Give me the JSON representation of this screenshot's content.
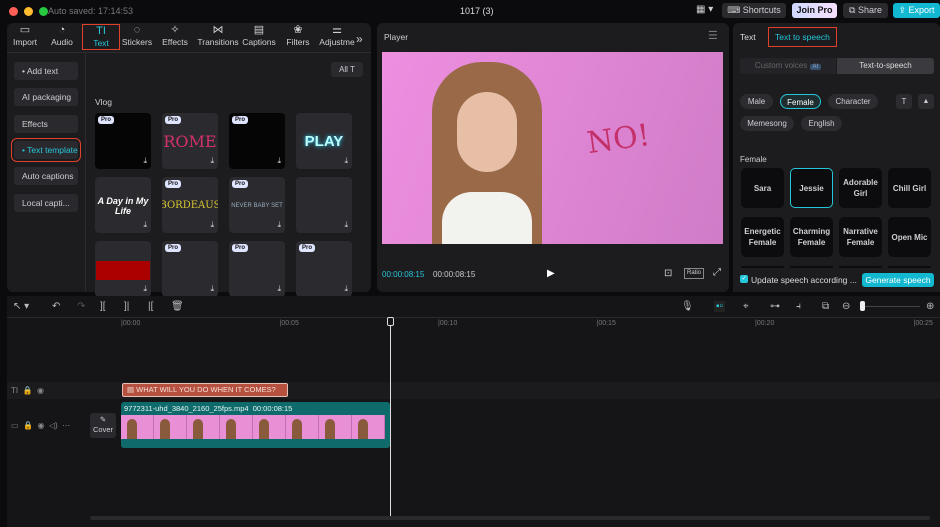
{
  "titlebar": {
    "autosave": "Auto saved: 17:14:53",
    "project": "1017 (3)",
    "shortcuts": "Shortcuts",
    "join_pro": "Join Pro",
    "share": "Share",
    "export": "Export"
  },
  "toolbar_tabs": [
    {
      "label": "Import",
      "icon": "import-icon"
    },
    {
      "label": "Audio",
      "icon": "audio-icon"
    },
    {
      "label": "Text",
      "icon": "text-icon",
      "active": true
    },
    {
      "label": "Stickers",
      "icon": "sticker-icon"
    },
    {
      "label": "Effects",
      "icon": "effects-icon"
    },
    {
      "label": "Transitions",
      "icon": "transition-icon"
    },
    {
      "label": "Captions",
      "icon": "captions-icon"
    },
    {
      "label": "Filters",
      "icon": "filters-icon"
    },
    {
      "label": "Adjustme",
      "icon": "adjust-icon"
    }
  ],
  "sidebar": [
    {
      "label": "• Add text"
    },
    {
      "label": "AI packaging"
    },
    {
      "label": "Effects"
    },
    {
      "label": "• Text template",
      "active": true
    },
    {
      "label": "Auto captions"
    },
    {
      "label": "Local capti..."
    }
  ],
  "library": {
    "filter": "All",
    "section": "Vlog",
    "pro_badge": "Pro",
    "templates": [
      {
        "text": "",
        "pro": true,
        "style": "black"
      },
      {
        "text": "ROME",
        "pro": true
      },
      {
        "text": "",
        "pro": true,
        "style": "black"
      },
      {
        "text": "PLAY",
        "pro": false
      },
      {
        "text": "A Day in My Life",
        "pro": false
      },
      {
        "text": "BORDEAUS",
        "pro": true
      },
      {
        "text": "NEVER BABY SET",
        "pro": true
      },
      {
        "text": "",
        "pro": false
      },
      {
        "text": "",
        "pro": false,
        "style": "red"
      },
      {
        "text": "",
        "pro": true
      },
      {
        "text": "",
        "pro": true
      },
      {
        "text": "",
        "pro": true
      }
    ]
  },
  "player": {
    "title": "Player",
    "overlay_text": "NO!",
    "current_time": "00:00:08:15",
    "total_time": "00:00:08:15",
    "ratio": "Ratio"
  },
  "right_panel": {
    "tabs": [
      "Text",
      "Text to speech"
    ],
    "active_tab": "Text to speech",
    "segments": [
      "Custom voices",
      "Text-to-speech"
    ],
    "segment_badge": "AI",
    "filters": [
      "Male",
      "Female",
      "Character",
      "Memesong",
      "English"
    ],
    "active_filter": "Female",
    "group_label": "Female",
    "voices": [
      "Sara",
      "Jessie",
      "Adorable Girl",
      "Chill Girl",
      "Energetic Female",
      "Charming Female",
      "Narrative Female",
      "Open Mic"
    ],
    "selected_voice": "Jessie",
    "update_label": "Update speech according ...",
    "update_checked": true,
    "generate": "Generate speech"
  },
  "timeline": {
    "ticks": [
      "00:00",
      "00:05",
      "00:10",
      "00:15",
      "00:20",
      "00:25"
    ],
    "text_clip": "WHAT WILL YOU DO WHEN IT COMES?",
    "video_clip": {
      "name": "9772311-uhd_3840_2160_25fps.mp4",
      "duration": "00:00:08:15"
    },
    "cover": "Cover"
  },
  "colors": {
    "accent": "#26c6da",
    "highlight": "#e0412b",
    "text_clip": "#b5513e",
    "video_clip": "#0f6b6b"
  }
}
